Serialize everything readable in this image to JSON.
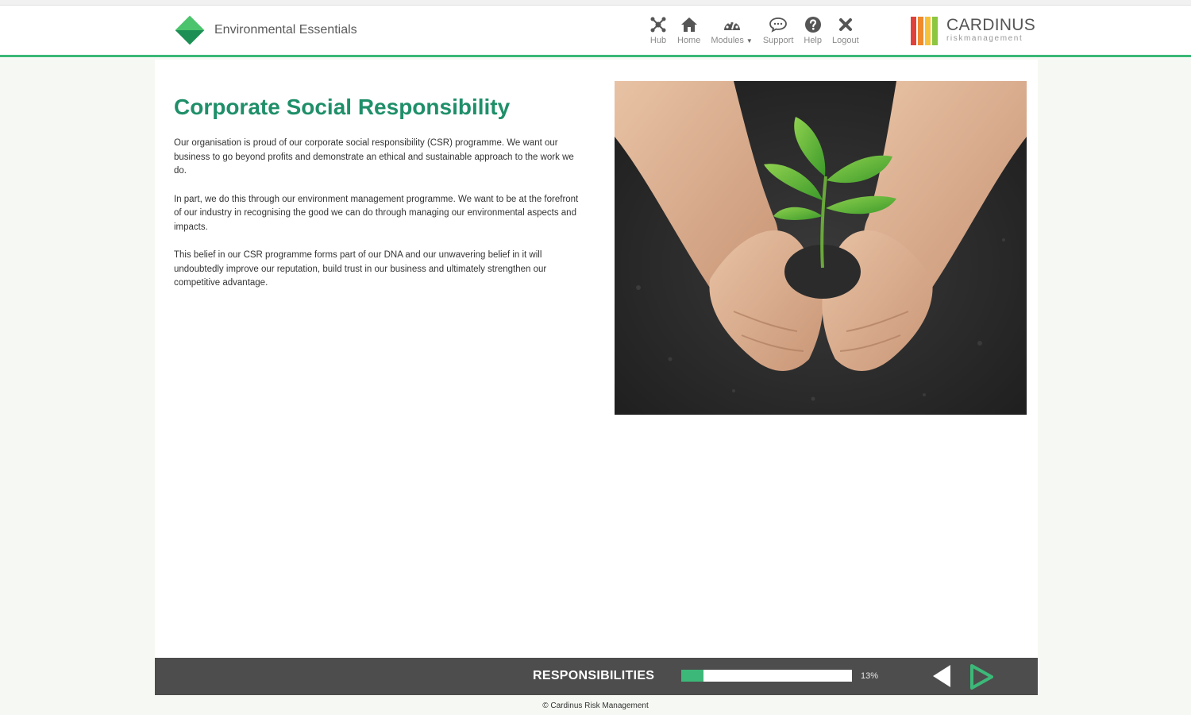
{
  "app": {
    "title": "Environmental Essentials"
  },
  "nav": {
    "items": [
      {
        "label": "Hub",
        "icon": "hub-icon"
      },
      {
        "label": "Home",
        "icon": "home-icon"
      },
      {
        "label": "Modules",
        "icon": "modules-icon"
      },
      {
        "label": "Support",
        "icon": "speech-bubble-icon"
      },
      {
        "label": "Help",
        "icon": "help-icon"
      },
      {
        "label": "Logout",
        "icon": "close-icon"
      }
    ]
  },
  "logo": {
    "name": "CARDINUS",
    "subtitle": "riskmanagement",
    "bar_colors": [
      "#e0413a",
      "#f08a2c",
      "#f5c23a",
      "#8dc63f"
    ]
  },
  "page": {
    "title": "Corporate Social Responsibility",
    "paragraphs": [
      "Our organisation is proud of our corporate social responsibility (CSR) programme. We want our business to go beyond profits and demonstrate an ethical and sustainable approach to the work we do.",
      "In part, we do this through our environment management programme. We want to be at the forefront of our industry in recognising the good we can do through managing our environmental aspects and impacts.",
      "This belief in our CSR programme forms part of our DNA and our unwavering belief in it will undoubtedly improve our reputation, build trust in our business and ultimately strengthen our competitive advantage."
    ],
    "image": "hands-holding-seedling-in-soil"
  },
  "footer": {
    "section": "RESPONSIBILITIES",
    "progress_percent": 13,
    "progress_label": "13%",
    "copyright": "Cardinus Risk Management"
  },
  "colors": {
    "accent": "#3cb878",
    "title": "#1f8f6a",
    "footer_bg": "#4d4d4d"
  }
}
